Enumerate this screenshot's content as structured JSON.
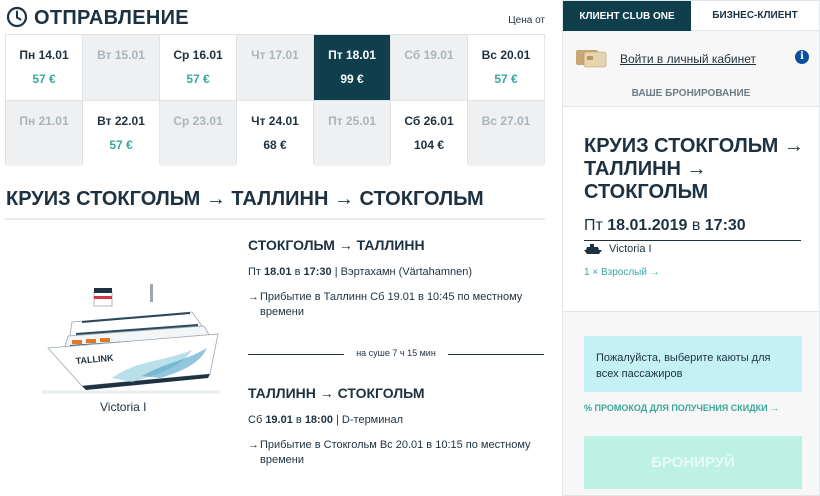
{
  "departure": {
    "title": "ОТПРАВЛЕНИЕ",
    "price_from": "Цена от",
    "days": [
      {
        "day": "Пн 14.01",
        "price": "57 €",
        "state": "available",
        "price_color": "teal"
      },
      {
        "day": "Вт 15.01",
        "price": "",
        "state": "disabled"
      },
      {
        "day": "Ср 16.01",
        "price": "57 €",
        "state": "available",
        "price_color": "teal"
      },
      {
        "day": "Чт 17.01",
        "price": "",
        "state": "disabled"
      },
      {
        "day": "Пт 18.01",
        "price": "99 €",
        "state": "selected"
      },
      {
        "day": "Сб 19.01",
        "price": "",
        "state": "disabled"
      },
      {
        "day": "Вс 20.01",
        "price": "57 €",
        "state": "available",
        "price_color": "teal"
      },
      {
        "day": "Пн 21.01",
        "price": "",
        "state": "disabled"
      },
      {
        "day": "Вт 22.01",
        "price": "57 €",
        "state": "available",
        "price_color": "teal"
      },
      {
        "day": "Ср 23.01",
        "price": "",
        "state": "disabled"
      },
      {
        "day": "Чт 24.01",
        "price": "68 €",
        "state": "available",
        "price_color": "dark"
      },
      {
        "day": "Пт 25.01",
        "price": "",
        "state": "disabled"
      },
      {
        "day": "Сб 26.01",
        "price": "104 €",
        "state": "available",
        "price_color": "dark"
      },
      {
        "day": "Вс 27.01",
        "price": "",
        "state": "disabled"
      }
    ]
  },
  "cruise": {
    "title": "КРУИЗ СТОКГОЛЬМ → ТАЛЛИНН → СТОКГОЛЬМ",
    "ship_name": "Victoria I",
    "ship_hull_text": "TALLINK",
    "leg1": {
      "title": "СТОКГОЛЬМ → ТАЛЛИНН",
      "day": "Пт",
      "date": "18.01",
      "at": "в",
      "time": "17:30",
      "port": "| Вэртахамн (Värtahamnen)",
      "arrival": "Прибытие в Таллинн Сб 19.01 в 10:45 по местному времени"
    },
    "on_land": "на суше 7 ч 15 мин",
    "leg2": {
      "title": "ТАЛЛИНН → СТОКГОЛЬМ",
      "day": "Сб",
      "date": "19.01",
      "at": "в",
      "time": "18:00",
      "port": "| D-терминал",
      "arrival": "Прибытие в Стокгольм Вс 20.01 в 10:15 по местному времени"
    },
    "arrow": "→"
  },
  "panel": {
    "tabs": [
      {
        "label": "КЛИЕНТ CLUB ONE",
        "active": true
      },
      {
        "label": "БИЗНЕС-КЛИЕНТ",
        "active": false
      }
    ],
    "login_link": "Войти в личный кабинет",
    "info_glyph": "i",
    "booking_label": "ВАШЕ БРОНИРОВАНИЕ",
    "title": "КРУИЗ СТОКГОЛЬМ → ТАЛЛИНН → СТОКГОЛЬМ",
    "date_prefix": "Пт",
    "date": "18.01.2019",
    "date_at": "в",
    "time": "17:30",
    "ship": "Victoria I",
    "passengers": "1 × Взрослый →",
    "notice": "Пожалуйста, выберите каюты для всех пассажиров",
    "promo": "% ПРОМОКОД ДЛЯ ПОЛУЧЕНИЯ СКИДКИ →",
    "book_button": "БРОНИРУЙ"
  },
  "colors": {
    "dark": "#1e3140",
    "navy": "#0f3e4c",
    "teal": "#3aa79a",
    "notice_bg": "#c3f1f6",
    "button_bg": "#bdf1e3",
    "info_blue": "#0b4f9c"
  },
  "icons": {
    "clock": "clock-icon",
    "card": "club-one-card-icon",
    "info": "info-icon",
    "ship": "ship-icon",
    "arrow": "arrow-right-icon"
  }
}
